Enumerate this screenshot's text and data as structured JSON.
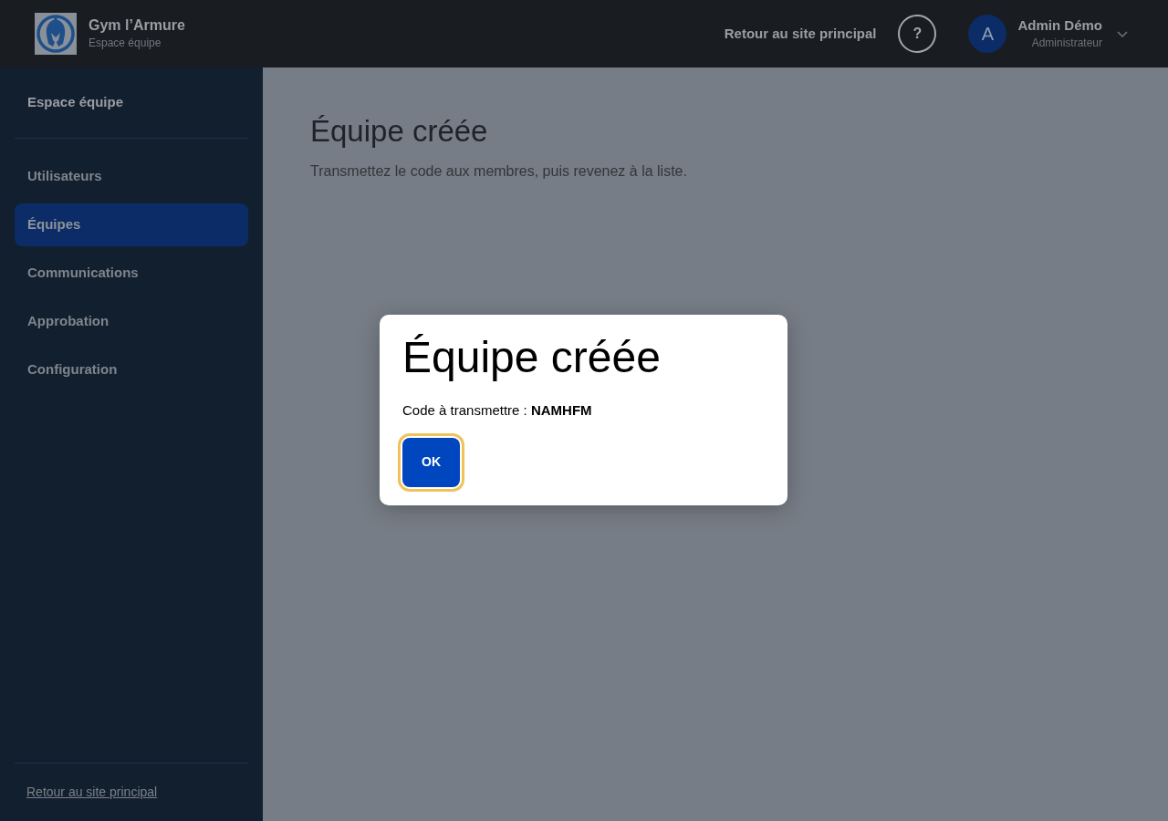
{
  "header": {
    "brand": {
      "name": "Gym l’Armure",
      "subtitle": "Espace équipe"
    },
    "back_link": "Retour au site principal",
    "help_button": "?",
    "user": {
      "avatar_letter": "A",
      "name": "Admin Démo",
      "role": "Administrateur"
    }
  },
  "sidebar": {
    "title": "Espace équipe",
    "items": [
      {
        "label": "Utilisateurs",
        "selected": false
      },
      {
        "label": "Équipes",
        "selected": true
      },
      {
        "label": "Communications",
        "selected": false
      },
      {
        "label": "Approbation",
        "selected": false
      },
      {
        "label": "Configuration",
        "selected": false
      }
    ],
    "footer_link": "Retour au site principal"
  },
  "main": {
    "title": "Équipe créée",
    "description": "Transmettez le code aux membres, puis revenez à la liste."
  },
  "dialog": {
    "title": "Équipe créée",
    "text": "Code à transmettre : **NAMHFM**",
    "button": {
      "label": "OK",
      "focused": true
    }
  }
}
